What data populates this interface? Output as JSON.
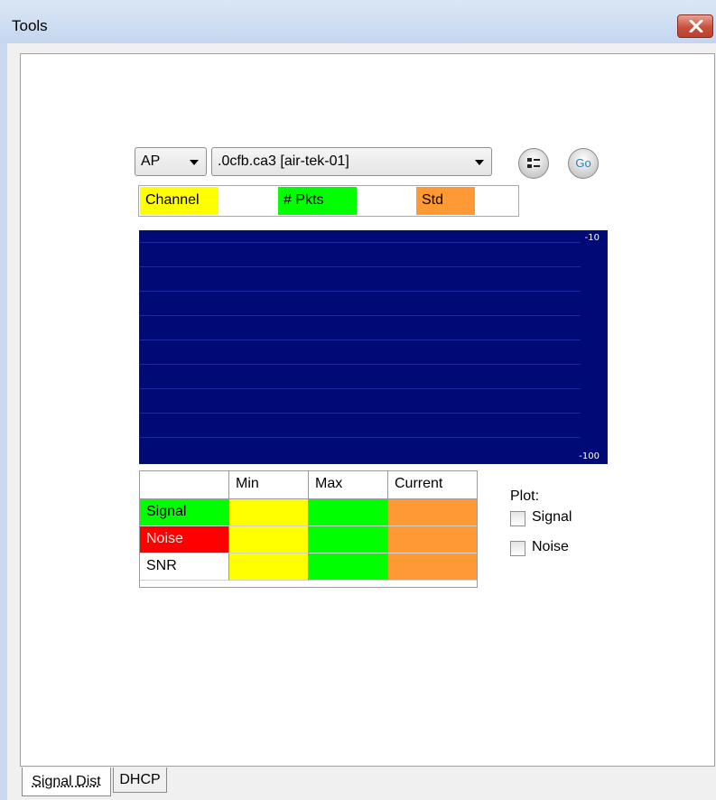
{
  "window": {
    "title": "Tools"
  },
  "toolbar": {
    "type_select": {
      "value": "AP"
    },
    "device_select": {
      "value": ".0cfb.ca3 [air-tek-01]"
    },
    "list_button_icon": "list-icon",
    "go_button_label": "Go"
  },
  "stats": {
    "channel_label": "Channel",
    "channel_value": "",
    "pkts_label": "# Pkts",
    "pkts_value": "",
    "std_label": "Std",
    "std_value": ""
  },
  "chart": {
    "y_max_label": "-10",
    "y_min_label": "-100",
    "background": "#000a77"
  },
  "table": {
    "headers": [
      "",
      "Min",
      "Max",
      "Current"
    ],
    "rows": [
      {
        "label": "Signal",
        "min": "",
        "max": "",
        "current": ""
      },
      {
        "label": "Noise",
        "min": "",
        "max": "",
        "current": ""
      },
      {
        "label": "SNR",
        "min": "",
        "max": "",
        "current": ""
      }
    ]
  },
  "plot": {
    "title": "Plot:",
    "signal_label": "Signal",
    "signal_checked": false,
    "noise_label": "Noise",
    "noise_checked": false
  },
  "tabs": [
    {
      "label": "Signal Dist",
      "active": true
    },
    {
      "label": "DHCP",
      "active": false
    }
  ],
  "colors": {
    "yellow": "#ffff00",
    "green": "#00ff00",
    "orange": "#ff9933",
    "red": "#ff0000",
    "chart_bg": "#000a77",
    "chart_grid": "#1b2a9e"
  }
}
